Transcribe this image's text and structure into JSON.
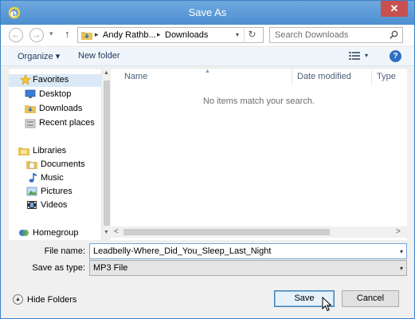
{
  "window": {
    "title": "Save As",
    "close_glyph": "✕"
  },
  "nav": {
    "back_glyph": "←",
    "forward_glyph": "→",
    "recent_glyph": "▾",
    "up_glyph": "↑",
    "breadcrumb": [
      "Andy Rathb...",
      "Downloads"
    ],
    "crumb_separator": "▸",
    "address_dropdown_glyph": "▾",
    "refresh_glyph": "↻",
    "search_placeholder": "Search Downloads"
  },
  "toolbar": {
    "organize_label": "Organize ▾",
    "new_folder_label": "New folder",
    "view_dropdown_glyph": "▾",
    "help_glyph": "?"
  },
  "sidebar": {
    "items": [
      {
        "label": "Favorites",
        "icon": "star-icon",
        "selected": true
      },
      {
        "label": "Desktop",
        "icon": "desktop-icon"
      },
      {
        "label": "Downloads",
        "icon": "downloads-icon"
      },
      {
        "label": "Recent places",
        "icon": "recent-places-icon"
      },
      {
        "label": "Libraries",
        "icon": "libraries-icon"
      },
      {
        "label": "Documents",
        "icon": "documents-icon"
      },
      {
        "label": "Music",
        "icon": "music-icon"
      },
      {
        "label": "Pictures",
        "icon": "pictures-icon"
      },
      {
        "label": "Videos",
        "icon": "videos-icon"
      },
      {
        "label": "Homegroup",
        "icon": "homegroup-icon"
      }
    ]
  },
  "file_list": {
    "columns": [
      "Name",
      "Date modified",
      "Type"
    ],
    "empty_message": "No items match your search."
  },
  "scrollbar": {
    "up_glyph": "▲",
    "down_glyph": "▼",
    "left_glyph": "<",
    "right_glyph": ">"
  },
  "form": {
    "file_name_label": "File name:",
    "file_name_value": "Leadbelly-Where_Did_You_Sleep_Last_Night",
    "save_type_label": "Save as type:",
    "save_type_value": "MP3 File",
    "dropdown_glyph": "▾"
  },
  "footer": {
    "hide_folders_label": "Hide Folders",
    "hide_folders_glyph": "▲",
    "save_label": "Save",
    "cancel_label": "Cancel"
  },
  "colors": {
    "title_bar": "#5b9bd5",
    "close_button": "#c75050",
    "accent": "#2f6fc3"
  }
}
